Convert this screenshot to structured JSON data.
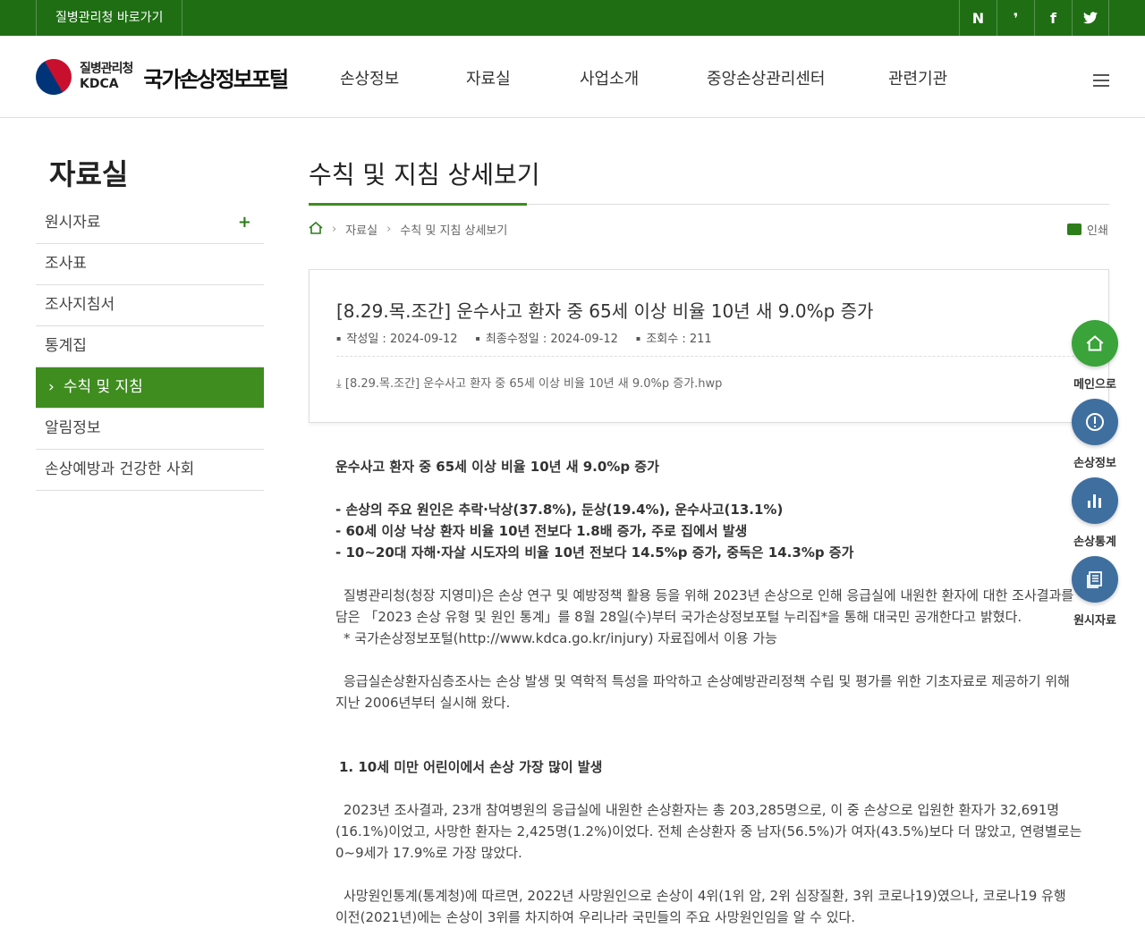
{
  "topbar": {
    "goto_label": "질병관리청 바로가기",
    "sns": [
      "N",
      "❜",
      "f",
      "🐦"
    ]
  },
  "header": {
    "logo_ko": "질병관리청",
    "logo_en": "KDCA",
    "portal_name": "국가손상정보포털",
    "nav": [
      "손상정보",
      "자료실",
      "사업소개",
      "중앙손상관리센터",
      "관련기관"
    ]
  },
  "sidebar": {
    "title": "자료실",
    "items": [
      {
        "label": "원시자료",
        "expand": "+"
      },
      {
        "label": "조사표"
      },
      {
        "label": "조사지침서"
      },
      {
        "label": "통계집"
      },
      {
        "label": "수칙 및 지침",
        "active": true
      },
      {
        "label": "알림정보"
      },
      {
        "label": "손상예방과 건강한 사회"
      }
    ]
  },
  "page": {
    "title": "수칙 및 지침 상세보기",
    "breadcrumb": [
      "자료실",
      "수칙 및 지침 상세보기"
    ],
    "print_label": "인쇄"
  },
  "article": {
    "subject": "[8.29.목.조간] 운수사고 환자 중 65세 이상 비율 10년 새 9.0%p 증가",
    "created": "작성일 : 2024-09-12",
    "modified": "최종수정일 : 2024-09-12",
    "views": "조회수 : 211",
    "attachment": "[8.29.목.조간] 운수사고 환자 중 65세 이상 비율 10년 새 9.0%p 증가.hwp"
  },
  "content": {
    "headline": "운수사고 환자 중 65세 이상 비율 10년 새 9.0%p 증가",
    "bullet1": "- 손상의 주요 원인은 추락·낙상(37.8%), 둔상(19.4%), 운수사고(13.1%)",
    "bullet2": "- 60세 이상 낙상 환자 비율 10년 전보다 1.8배 증가, 주로 집에서 발생",
    "bullet3": "- 10~20대 자해·자살 시도자의 비율 10년 전보다 14.5%p 증가, 중독은 14.3%p 증가",
    "para1": "질병관리청(청장 지영미)은 손상 연구 및 예방정책 활용 등을 위해 2023년 손상으로 인해 응급실에 내원한 환자에 대한 조사결과를 담은 「2023 손상 유형 및 원인 통계」를 8월 28일(수)부터 국가손상정보포털 누리집*을 통해 대국민 공개한다고 밝혔다.",
    "para1_note": "* 국가손상정보포털(http://www.kdca.go.kr/injury) 자료집에서 이용 가능",
    "para2": "응급실손상환자심층조사는 손상 발생 및 역학적 특성을 파악하고 손상예방관리정책 수립 및 평가를 위한 기초자료로 제공하기 위해 지난 2006년부터 실시해 왔다.",
    "section1": "1. 10세 미만 어린이에서 손상 가장 많이 발생",
    "para3": "2023년 조사결과, 23개 참여병원의 응급실에 내원한 손상환자는 총 203,285명으로, 이 중 손상으로 입원한 환자가 32,691명(16.1%)이었고, 사망한 환자는 2,425명(1.2%)이었다. 전체 손상환자 중 남자(56.5%)가 여자(43.5%)보다 더 많았고, 연령별로는 0~9세가 17.9%로 가장 많았다.",
    "para4": "사망원인통계(통계청)에 따르면, 2022년 사망원인으로 손상이 4위(1위 암, 2위 심장질환, 3위 코로나19)였으나, 코로나19 유행 이전(2021년)에는 손상이 3위를 차지하여 우리나라 국민들의 주요 사망원인임을 알 수 있다."
  },
  "quick_menu": [
    {
      "label": "메인으로",
      "icon": "home-icon",
      "color": "#3aa33a"
    },
    {
      "label": "손상정보",
      "icon": "alert-icon",
      "color": "#3f6f9f"
    },
    {
      "label": "손상통계",
      "icon": "bar-chart-icon",
      "color": "#3f6f9f"
    },
    {
      "label": "원시자료",
      "icon": "document-icon",
      "color": "#3f6f9f"
    }
  ]
}
